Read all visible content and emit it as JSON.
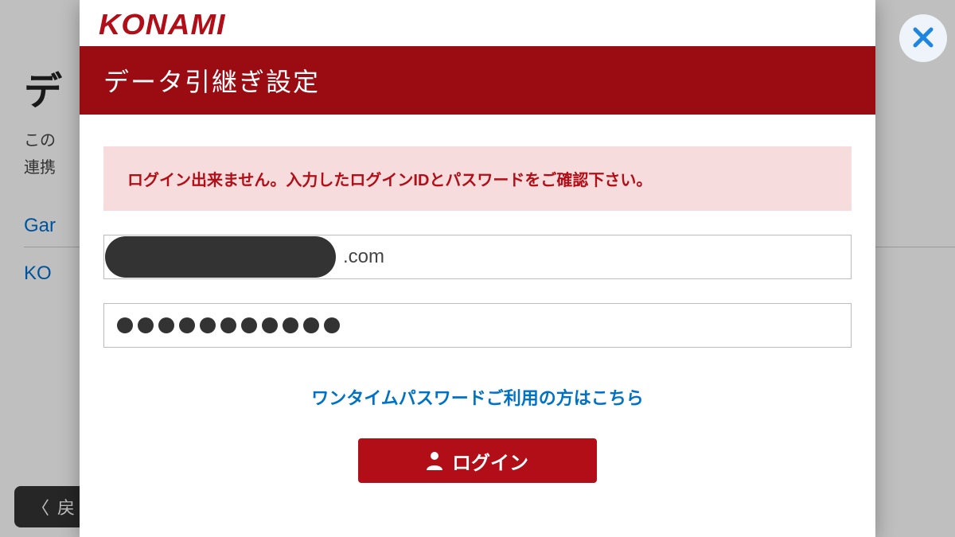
{
  "background": {
    "title": "デ",
    "line1": "この",
    "line2": "連携",
    "link1": "Gar",
    "link2": "KO",
    "back_prefix": "戻"
  },
  "logo": "KONAMI",
  "modal": {
    "title": "データ引継ぎ設定",
    "error_message": "ログイン出来ません。入力したログインIDとパスワードをご確認下さい。",
    "login_id_suffix": ".com",
    "password_length": 11,
    "otp_link": "ワンタイムパスワードご利用の方はこちら",
    "login_button": "ログイン"
  },
  "close_label": "閉じる"
}
